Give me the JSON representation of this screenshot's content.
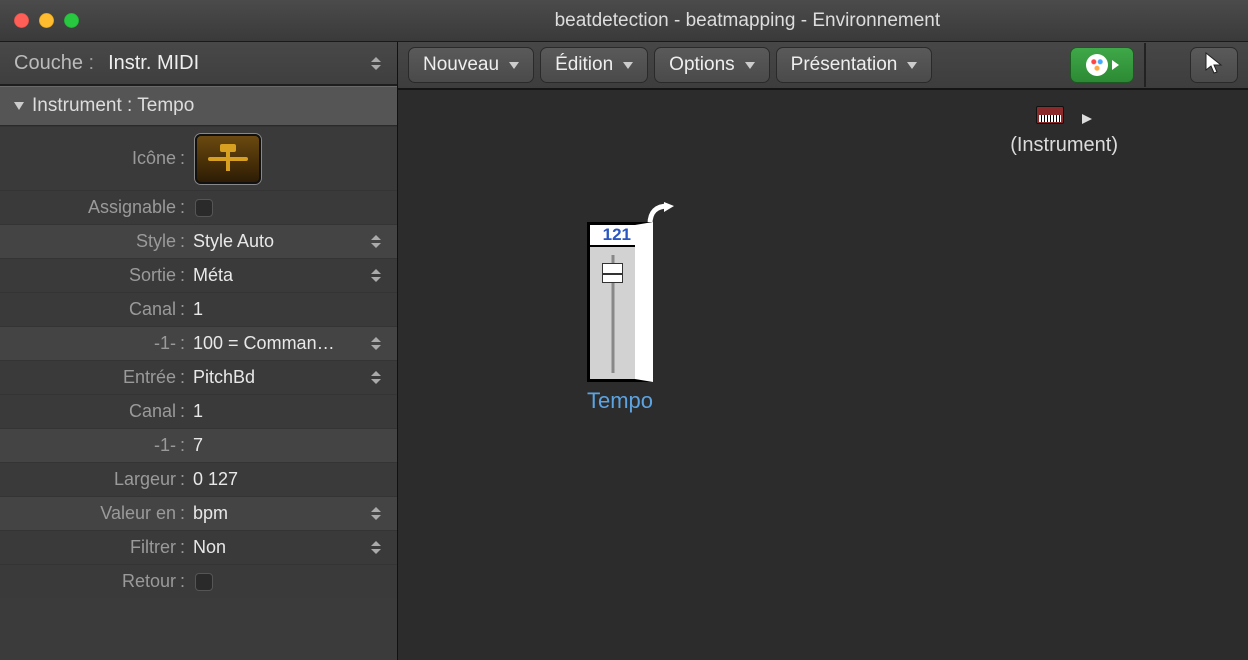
{
  "window": {
    "title": "beatdetection - beatmapping - Environnement"
  },
  "inspector": {
    "layer_label": "Couche",
    "layer_value": "Instr. MIDI",
    "section_title": "Instrument : Tempo",
    "rows": {
      "icon_label": "Icône",
      "assignable_label": "Assignable",
      "style_label": "Style",
      "style_value": "Style Auto",
      "sortie_label": "Sortie",
      "sortie_value": "Méta",
      "canal1_label": "Canal",
      "canal1_value": "1",
      "neg1a_label": "-1-",
      "neg1a_value": "100 = Comman…",
      "entree_label": "Entrée",
      "entree_value": "PitchBd",
      "canal2_label": "Canal",
      "canal2_value": "1",
      "neg1b_label": "-1-",
      "neg1b_value": "7",
      "largeur_label": "Largeur",
      "largeur_value": "0    127",
      "valeur_label": "Valeur en",
      "valeur_value": "bpm",
      "filtrer_label": "Filtrer",
      "filtrer_value": "Non",
      "retour_label": "Retour"
    }
  },
  "toolbar": {
    "nouveau": "Nouveau",
    "edition": "Édition",
    "options": "Options",
    "presentation": "Présentation"
  },
  "canvas": {
    "instrument_label": "(Instrument)",
    "fader": {
      "value": "121",
      "name": "Tempo"
    }
  },
  "icons": {
    "palette": "palette-icon",
    "pointer": "pointer-icon"
  }
}
